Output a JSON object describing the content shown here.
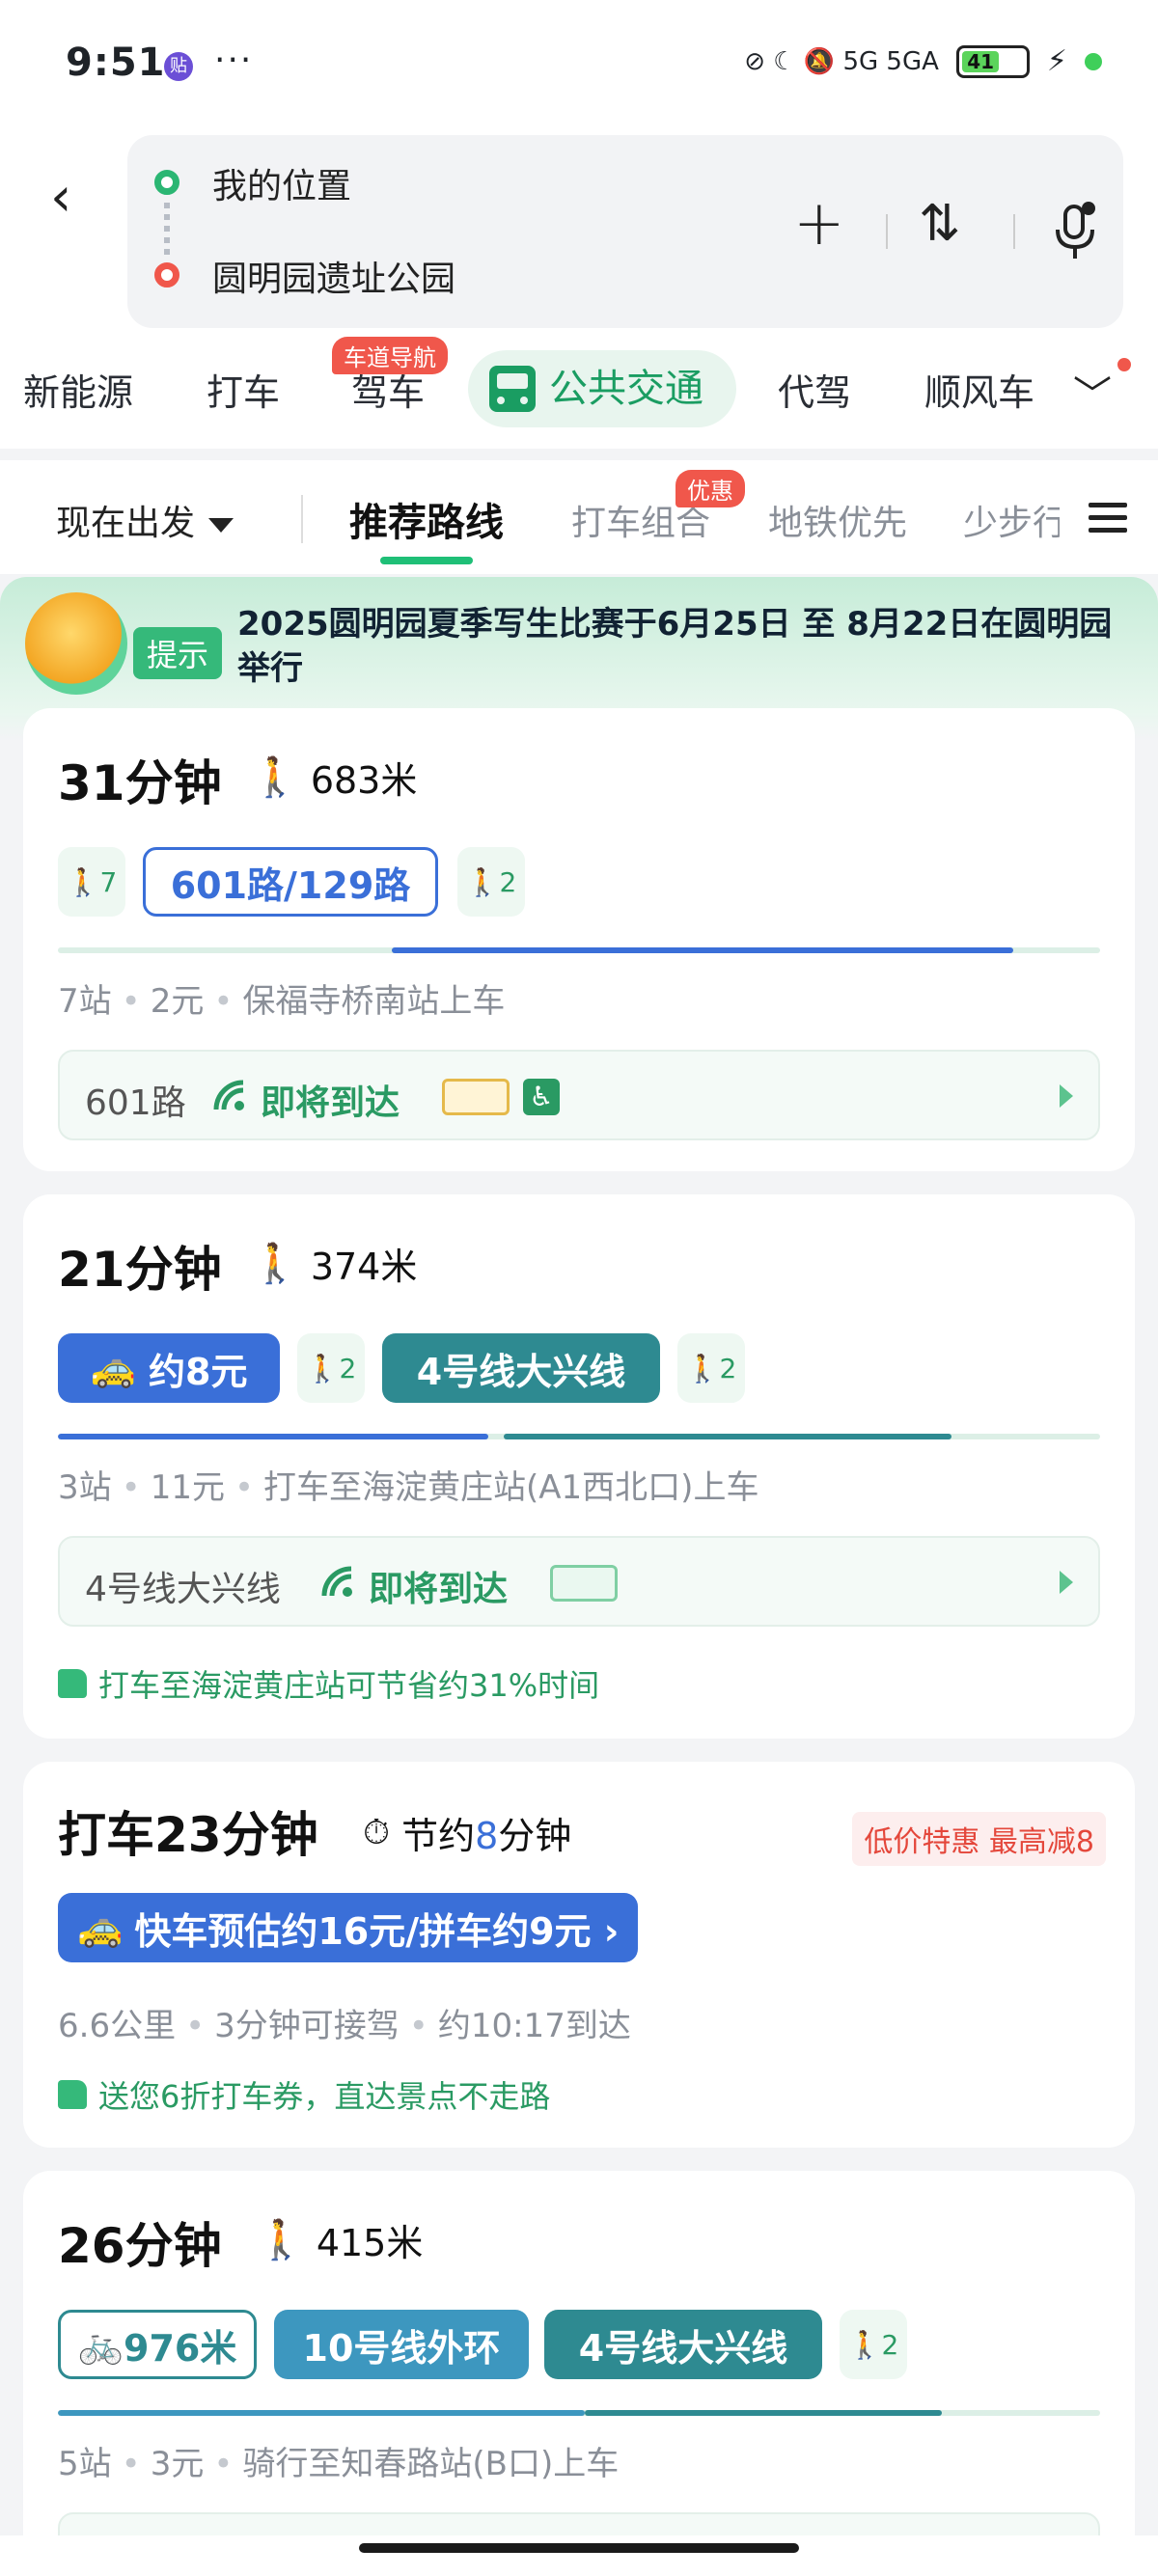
{
  "status": {
    "time": "9:51",
    "app_badge": "贴",
    "more": "···",
    "icons": "⊘ ☾ 🔕 5G 5GA",
    "battery": "41"
  },
  "route": {
    "from": "我的位置",
    "to": "圆明园遗址公园",
    "add": "+",
    "swap": "⇅"
  },
  "modes": {
    "items": [
      "新能源",
      "打车",
      "驾车",
      "公共交通",
      "代驾",
      "顺风车"
    ],
    "drive_badge": "车道导航",
    "more": "﹀"
  },
  "filters": {
    "depart": "现在出发",
    "tabs": [
      "推荐路线",
      "打车组合",
      "地铁优先",
      "少步行"
    ],
    "combo_badge": "优惠"
  },
  "notice": {
    "tag": "提示",
    "text": "2025圆明园夏季写生比赛于6月25日 至 8月22日在圆明园举行"
  },
  "routes": [
    {
      "duration": "31分钟",
      "walk": "683米",
      "segments": {
        "walk1": "7",
        "bus": "601路/129路",
        "walk2": "2"
      },
      "meta": [
        "7站",
        "2元",
        "保福寺桥南站上车"
      ],
      "arrival": {
        "line": "601路",
        "status": "即将到达"
      }
    },
    {
      "duration": "21分钟",
      "walk": "374米",
      "segments": {
        "taxi": "约8元",
        "walk1": "2",
        "metro": "4号线大兴线",
        "walk2": "2"
      },
      "meta": [
        "3站",
        "11元",
        "打车至海淀黄庄站(A1西北口)上车"
      ],
      "arrival": {
        "line": "4号线大兴线",
        "status": "即将到达"
      },
      "tip": "打车至海淀黄庄站可节省约31%时间"
    },
    {
      "duration": "打车23分钟",
      "save_prefix": "节约",
      "save_num": "8",
      "save_suffix": "分钟",
      "promo": "低价特惠 最高减8",
      "button": "快车预估约16元/拼车约9元 ›",
      "meta": [
        "6.6公里",
        "3分钟可接驾",
        "约10:17到达"
      ],
      "tip": "送您6折打车券，直达景点不走路"
    },
    {
      "duration": "26分钟",
      "walk": "415米",
      "segments": {
        "bike": "976米",
        "metro1": "10号线外环",
        "metro2": "4号线大兴线",
        "walk": "2"
      },
      "meta": [
        "5站",
        "3元",
        "骑行至知春路站(B口)上车"
      ]
    }
  ],
  "colors": {
    "accent_green": "#1a9d62",
    "bus_blue": "#3a6fd8",
    "metro_teal": "#2e8a91",
    "alert_red": "#f0574b"
  }
}
